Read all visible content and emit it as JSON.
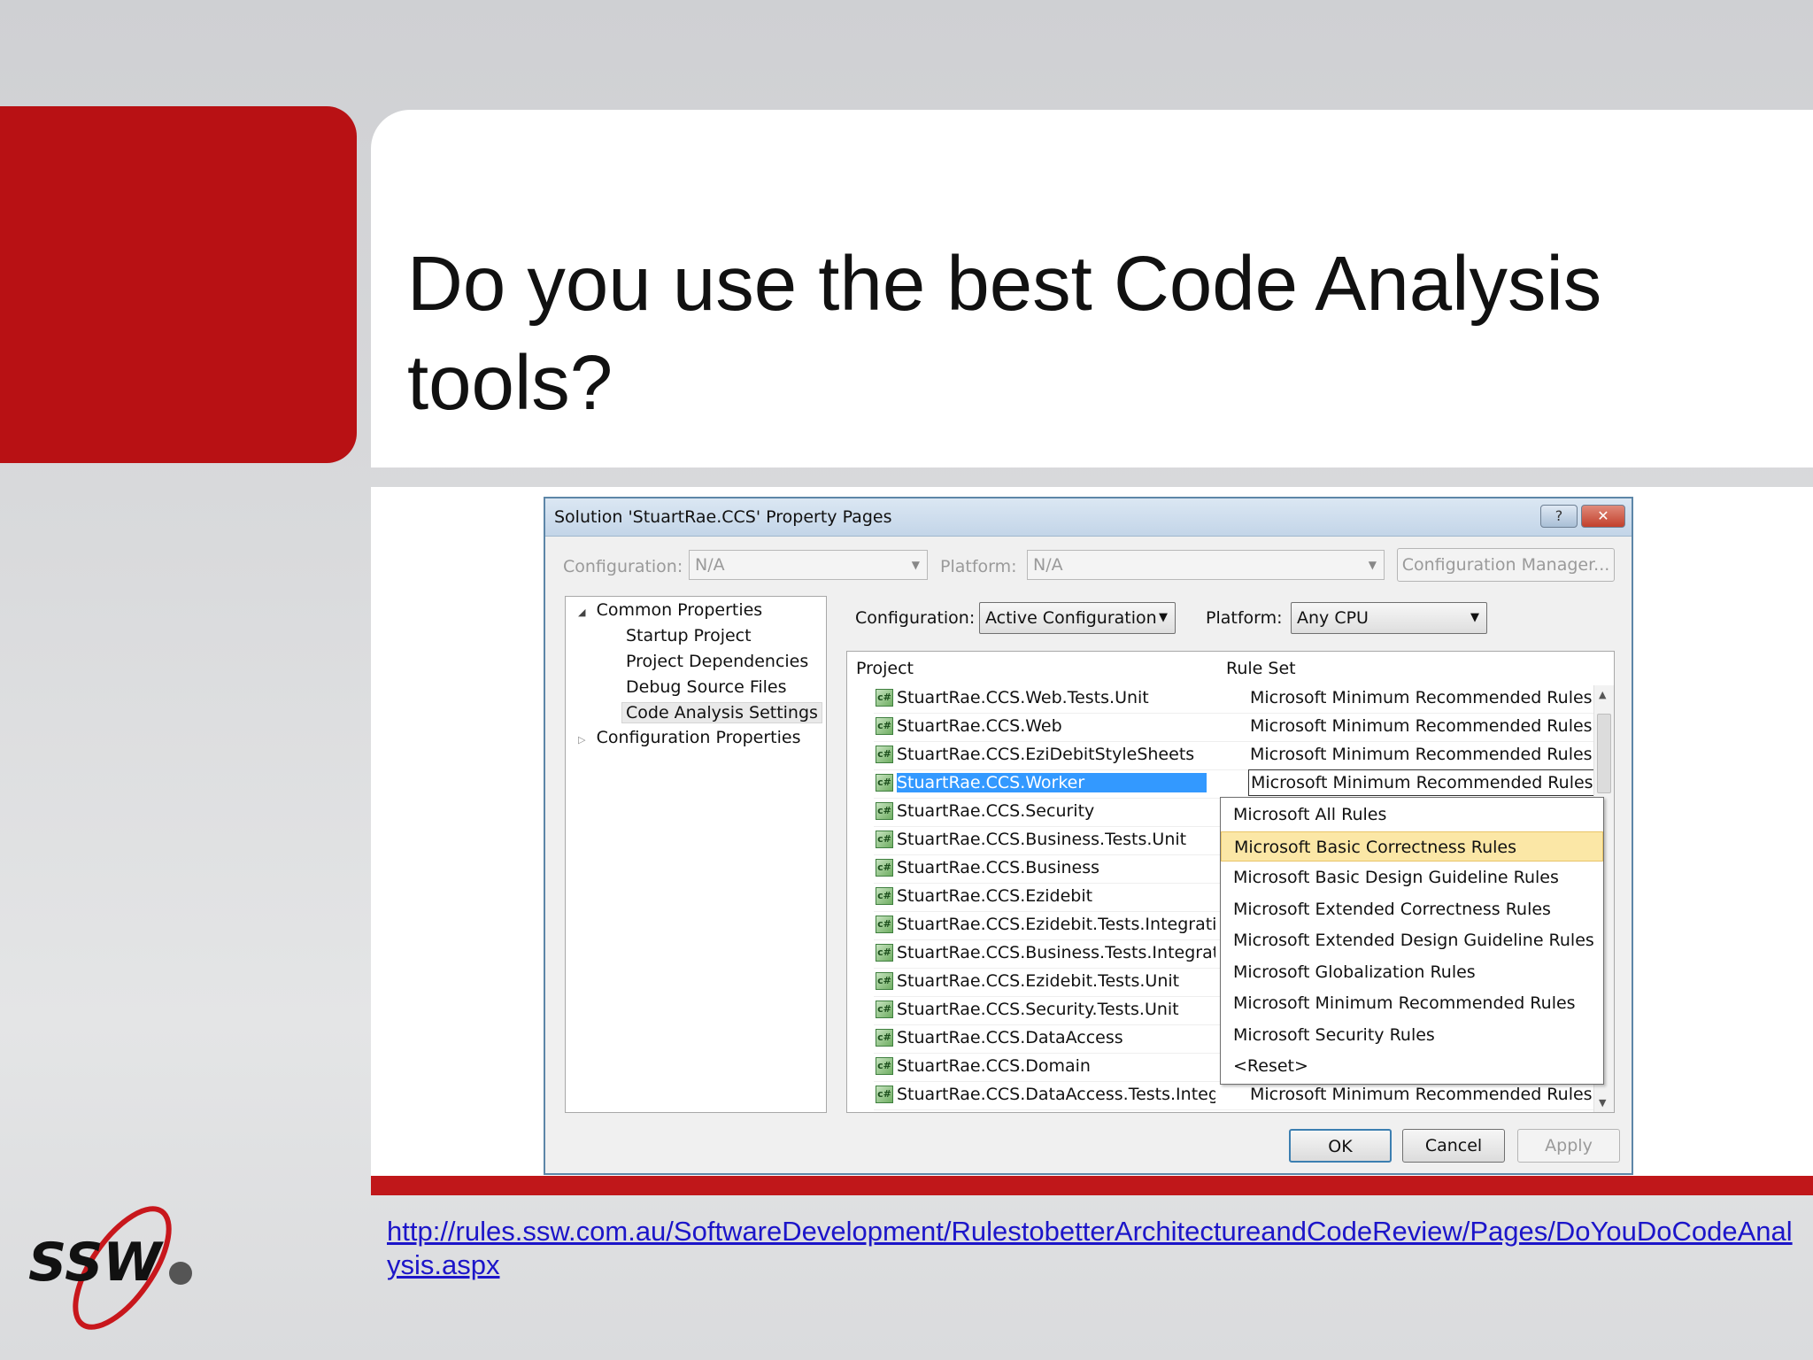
{
  "slide": {
    "title_line1": "Do you use the best Code Analysis",
    "title_line2": "tools?",
    "link_text": "http://rules.ssw.com.au/SoftwareDevelopment/RulestobetterArchitectureandCodeReview/Pages/DoYouDoCodeAnalysis.aspx",
    "logo_text": "SSW"
  },
  "dialog": {
    "title": "Solution 'StuartRae.CCS' Property Pages",
    "help_glyph": "?",
    "close_glyph": "✕",
    "top_bar": {
      "configuration_label": "Configuration:",
      "configuration_value": "N/A",
      "platform_label": "Platform:",
      "platform_value": "N/A",
      "config_manager_label": "Configuration Manager..."
    },
    "tree": {
      "common_properties": "Common Properties",
      "startup_project": "Startup Project",
      "project_dependencies": "Project Dependencies",
      "debug_source_files": "Debug Source Files",
      "code_analysis_settings": "Code Analysis Settings",
      "configuration_properties": "Configuration Properties"
    },
    "inner": {
      "configuration_label": "Configuration:",
      "configuration_value": "Active Configuration",
      "platform_label": "Platform:",
      "platform_value": "Any CPU"
    },
    "grid": {
      "col_project": "Project",
      "col_rule_set": "Rule Set",
      "rows": [
        {
          "project": "StuartRae.CCS.Web.Tests.Unit",
          "rule_set": "Microsoft Minimum Recommended Rules"
        },
        {
          "project": "StuartRae.CCS.Web",
          "rule_set": "Microsoft Minimum Recommended Rules"
        },
        {
          "project": "StuartRae.CCS.EziDebitStyleSheets",
          "rule_set": "Microsoft Minimum Recommended Rules"
        },
        {
          "project": "StuartRae.CCS.Worker",
          "rule_set": "Microsoft Minimum Recommended Rules"
        },
        {
          "project": "StuartRae.CCS.Security",
          "rule_set": ""
        },
        {
          "project": "StuartRae.CCS.Business.Tests.Unit",
          "rule_set": ""
        },
        {
          "project": "StuartRae.CCS.Business",
          "rule_set": ""
        },
        {
          "project": "StuartRae.CCS.Ezidebit",
          "rule_set": ""
        },
        {
          "project": "StuartRae.CCS.Ezidebit.Tests.Integration",
          "rule_set": ""
        },
        {
          "project": "StuartRae.CCS.Business.Tests.Integration",
          "rule_set": ""
        },
        {
          "project": "StuartRae.CCS.Ezidebit.Tests.Unit",
          "rule_set": ""
        },
        {
          "project": "StuartRae.CCS.Security.Tests.Unit",
          "rule_set": ""
        },
        {
          "project": "StuartRae.CCS.DataAccess",
          "rule_set": ""
        },
        {
          "project": "StuartRae.CCS.Domain",
          "rule_set": ""
        },
        {
          "project": "StuartRae.CCS.DataAccess.Tests.Integratio",
          "rule_set": "Microsoft Minimum Recommended Rules"
        }
      ]
    },
    "dropdown_options": [
      "Microsoft All Rules",
      "Microsoft Basic Correctness Rules",
      "Microsoft Basic Design Guideline Rules",
      "Microsoft Extended Correctness Rules",
      "Microsoft Extended Design Guideline Rules",
      "Microsoft Globalization Rules",
      "Microsoft Minimum Recommended Rules",
      "Microsoft Security Rules",
      "<Reset>"
    ],
    "buttons": {
      "ok": "OK",
      "cancel": "Cancel",
      "apply": "Apply"
    }
  }
}
